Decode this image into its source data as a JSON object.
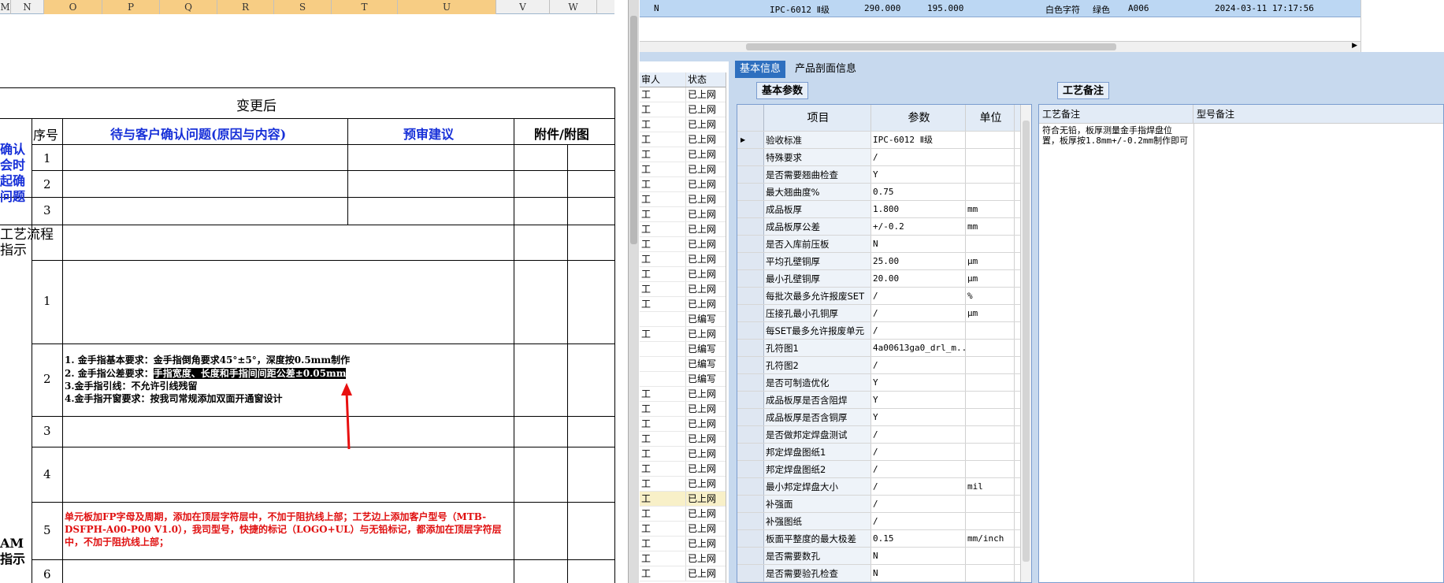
{
  "sheet": {
    "columns": [
      "M",
      "N",
      "O",
      "P",
      "Q",
      "R",
      "S",
      "T",
      "U",
      "V",
      "W"
    ],
    "after_change": "变更后",
    "seq_header": "序号",
    "question_header": "待与客户确认问题(原因与内容)",
    "prereview_header": "预审建议",
    "attachment_header": "附件/附图",
    "left_confirm": "确认\n会时\n起确\n问题",
    "process_flow": "工艺流程\n指示",
    "left_bottom": "AM\n指示",
    "rows1": [
      "1",
      "2",
      "3"
    ],
    "rows2": [
      "1",
      "2",
      "3",
      "4",
      "5",
      "6"
    ],
    "gold_lines": [
      "1. 金手指基本要求：金手指倒角要求45°±5°，深度按0.5mm制作",
      "2. 金手指公差要求：",
      "3.金手指引线：不允许引线残留",
      "4.金手指开窗要求：按我司常规添加双面开通窗设计"
    ],
    "gold_highlight": "手指宽度、长度和手指间间距公差±0.05mm",
    "red_note": "单元板加FP字母及周期，添加在顶层字符层中，不加于阻抗线上部；工艺边上添加客户型号（MTB-DSFPH-A00-P00 V1.0），我司型号，快捷的标记（LOGO+UL）与无铅标记，都添加在顶层字符层中，不加于阻抗线上部；"
  },
  "top_row": {
    "c1": "N",
    "c2": "IPC-6012 Ⅱ级",
    "c3": "290.000",
    "c4": "195.000",
    "c5": "白色字符",
    "c6": "绿色",
    "c7": "A006",
    "c8": "2024-03-11 17:17:56"
  },
  "midlist": {
    "h1": "审人",
    "h2": "状态",
    "rows": [
      [
        "工",
        "已上网"
      ],
      [
        "工",
        "已上网"
      ],
      [
        "工",
        "已上网"
      ],
      [
        "工",
        "已上网"
      ],
      [
        "工",
        "已上网"
      ],
      [
        "工",
        "已上网"
      ],
      [
        "工",
        "已上网"
      ],
      [
        "工",
        "已上网"
      ],
      [
        "工",
        "已上网"
      ],
      [
        "工",
        "已上网"
      ],
      [
        "工",
        "已上网"
      ],
      [
        "工",
        "已上网"
      ],
      [
        "工",
        "已上网"
      ],
      [
        "工",
        "已上网"
      ],
      [
        "工",
        "已上网"
      ],
      [
        "",
        "已编写"
      ],
      [
        "工",
        "已上网"
      ],
      [
        "",
        "已编写"
      ],
      [
        "",
        "已编写"
      ],
      [
        "",
        "已编写"
      ],
      [
        "工",
        "已上网"
      ],
      [
        "工",
        "已上网"
      ],
      [
        "工",
        "已上网"
      ],
      [
        "工",
        "已上网"
      ],
      [
        "工",
        "已上网"
      ],
      [
        "工",
        "已上网"
      ],
      [
        "工",
        "已上网"
      ],
      [
        "工",
        "已上网"
      ],
      [
        "工",
        "已上网"
      ],
      [
        "工",
        "已上网"
      ],
      [
        "工",
        "已上网"
      ],
      [
        "工",
        "已上网"
      ],
      [
        "工",
        "已上网"
      ]
    ]
  },
  "tabs": {
    "basic": "基本信息",
    "profile": "产品剖面信息",
    "basic_params": "基本参数",
    "process_notes": "工艺备注"
  },
  "params": {
    "headers": [
      "项目",
      "参数",
      "单位"
    ],
    "rows": [
      [
        "验收标准",
        "IPC-6012 Ⅱ级",
        ""
      ],
      [
        "特殊要求",
        "/",
        ""
      ],
      [
        "是否需要翘曲检查",
        "Y",
        ""
      ],
      [
        "最大翘曲度%",
        "0.75",
        ""
      ],
      [
        "成品板厚",
        "1.800",
        "mm"
      ],
      [
        "成品板厚公差",
        "+/-0.2",
        "mm"
      ],
      [
        "是否入库前压板",
        "N",
        ""
      ],
      [
        "平均孔壁铜厚",
        "25.00",
        "μm"
      ],
      [
        "最小孔壁铜厚",
        "20.00",
        "μm"
      ],
      [
        "每批次最多允许报废SET",
        "/",
        "%"
      ],
      [
        "压接孔最小孔铜厚",
        "/",
        "μm"
      ],
      [
        "每SET最多允许报废单元",
        "/",
        ""
      ],
      [
        "孔符图1",
        "4a00613ga0_drl_m...",
        ""
      ],
      [
        "孔符图2",
        "/",
        ""
      ],
      [
        "是否可制造优化",
        "Y",
        ""
      ],
      [
        "成品板厚是否含阻焊",
        "Y",
        ""
      ],
      [
        "成品板厚是否含铜厚",
        "Y",
        ""
      ],
      [
        "是否做邦定焊盘测试",
        "/",
        ""
      ],
      [
        "邦定焊盘图纸1",
        "/",
        ""
      ],
      [
        "邦定焊盘图纸2",
        "/",
        ""
      ],
      [
        "最小邦定焊盘大小",
        "/",
        "mil"
      ],
      [
        "补强面",
        "/",
        ""
      ],
      [
        "补强图纸",
        "/",
        ""
      ],
      [
        "板面平整度的最大极差",
        "0.15",
        "mm/inch"
      ],
      [
        "是否需要数孔",
        "N",
        ""
      ],
      [
        "是否需要验孔检查",
        "N",
        ""
      ]
    ]
  },
  "notes": {
    "h1": "工艺备注",
    "h2": "型号备注",
    "text": "符合无铅，板厚测量金手指焊盘位置，板厚按1.8mm+/-0.2mm制作即可"
  }
}
